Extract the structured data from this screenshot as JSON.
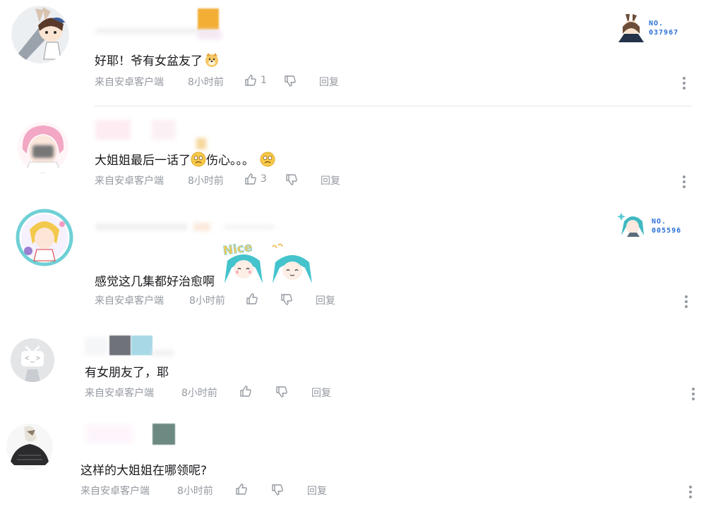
{
  "comments": [
    {
      "text": "好耶！爷有女盆友了",
      "source": "来自安卓客户端",
      "time": "8小时前",
      "likes": "1",
      "reply": "回复",
      "fan_badge": {
        "line1": "NO.",
        "line2": "037967"
      }
    },
    {
      "text": "大姐姐最后一话了",
      "text_after": "伤心。。。",
      "source": "来自安卓客户端",
      "time": "8小时前",
      "likes": "3",
      "reply": "回复"
    },
    {
      "text": "感觉这几集都好治愈啊",
      "source": "来自安卓客户端",
      "time": "8小时前",
      "likes": "",
      "reply": "回复",
      "fan_badge": {
        "line1": "NO.",
        "line2": "005596"
      },
      "sticker_text": "Nice"
    },
    {
      "text": "有女朋友了，耶",
      "source": "来自安卓客户端",
      "time": "8小时前",
      "likes": "",
      "reply": "回复"
    },
    {
      "text": "这样的大姐姐在哪领呢?",
      "source": "来自安卓客户端",
      "time": "8小时前",
      "likes": "",
      "reply": "回复"
    }
  ],
  "icons": {
    "like": "thumbs-up-icon",
    "dislike": "thumbs-down-icon",
    "more": "more-vertical-icon"
  },
  "colors": {
    "meta_gray": "#9499a0",
    "badge_blue": "#2a6fd6",
    "divider": "#e3e5e7"
  }
}
